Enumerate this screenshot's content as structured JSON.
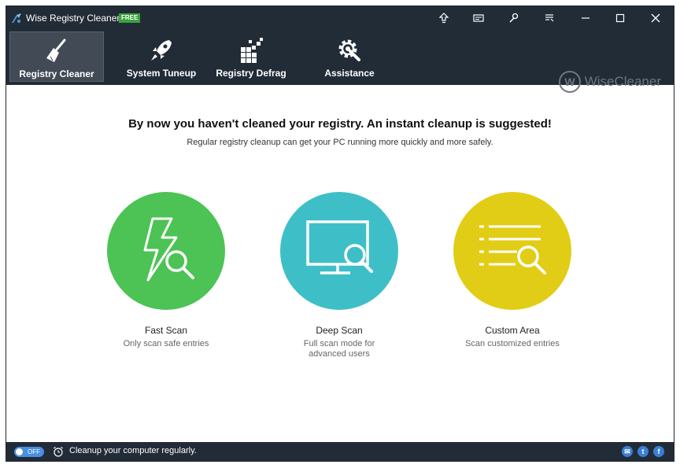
{
  "window": {
    "title": "Wise Registry Cleaner 9",
    "badge": "FREE",
    "controls": [
      "upgrade-icon",
      "message-icon",
      "tools-icon",
      "menu-icon",
      "minimize-icon",
      "maximize-icon",
      "close-icon"
    ]
  },
  "toolbar": {
    "items": [
      {
        "label": "Registry Cleaner",
        "icon": "broom-icon",
        "active": true
      },
      {
        "label": "System Tuneup",
        "icon": "rocket-icon",
        "active": false
      },
      {
        "label": "Registry Defrag",
        "icon": "defrag-icon",
        "active": false
      },
      {
        "label": "Assistance",
        "icon": "gear-wrench-icon",
        "active": false
      }
    ],
    "brand": "WiseCleaner"
  },
  "main": {
    "headline": "By now you haven't cleaned your registry. An instant cleanup is suggested!",
    "subline": "Regular registry cleanup can get your PC running more quickly and more safely.",
    "scans": [
      {
        "title": "Fast Scan",
        "description": "Only scan safe entries",
        "color": "#4cc354",
        "icon": "lightning-search-icon"
      },
      {
        "title": "Deep Scan",
        "description": "Full scan mode for advanced users",
        "color": "#3ebfc8",
        "icon": "monitor-search-icon"
      },
      {
        "title": "Custom Area",
        "description": "Scan customized entries",
        "color": "#e2cd16",
        "icon": "list-search-icon"
      }
    ]
  },
  "status": {
    "toggle": "OFF",
    "message": "Cleanup your computer regularly.",
    "social": [
      "mail-icon",
      "twitter-icon",
      "facebook-icon"
    ],
    "social_glyphs": {
      "mail": "✉",
      "twitter": "t",
      "facebook": "f"
    }
  },
  "colors": {
    "chrome": "#222c37",
    "active_tab": "#414a55",
    "toggle": "#4a8fe0"
  }
}
